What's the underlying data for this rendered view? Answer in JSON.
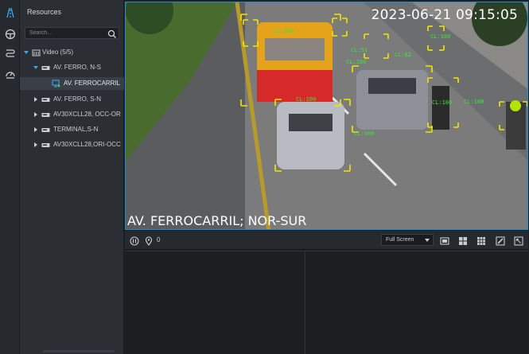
{
  "panel": {
    "title": "Resources",
    "search_placeholder": "Search..."
  },
  "tree": [
    {
      "label": "Video (5/5)",
      "level": 0,
      "expanded": true,
      "icon": "video-group-icon"
    },
    {
      "label": "AV. FERRO, N-S",
      "level": 1,
      "expanded": true,
      "icon": "dvr-icon"
    },
    {
      "label": "AV. FERROCARRIL",
      "level": 2,
      "selected": true,
      "icon": "camera-icon"
    },
    {
      "label": "AV. FERRO, S-N",
      "level": 1,
      "expanded": false,
      "icon": "dvr-icon"
    },
    {
      "label": "AV30XCLL28, OCC-OR",
      "level": 1,
      "expanded": false,
      "icon": "dvr-icon"
    },
    {
      "label": "TERMINAL,S-N",
      "level": 1,
      "expanded": false,
      "icon": "dvr-icon"
    },
    {
      "label": "AV30XCLL28,ORI-OCC",
      "level": 1,
      "expanded": false,
      "icon": "dvr-icon"
    }
  ],
  "video": {
    "timestamp": "2023-06-21 09:15:05",
    "caption": "AV. FERROCARRIL; NOR-SUR",
    "detections": [
      "CL:100",
      "CL:100",
      "CL:51",
      "CL:100",
      "CL:82",
      "CL:100",
      "CL:100",
      "CL:100",
      "CL:100"
    ]
  },
  "controls": {
    "poi_count": "0",
    "fullscreen_label": "Full Screen"
  },
  "colors": {
    "accent": "#1b8fd8",
    "detection_box": "#f2e600",
    "detection_label": "#38e838"
  }
}
